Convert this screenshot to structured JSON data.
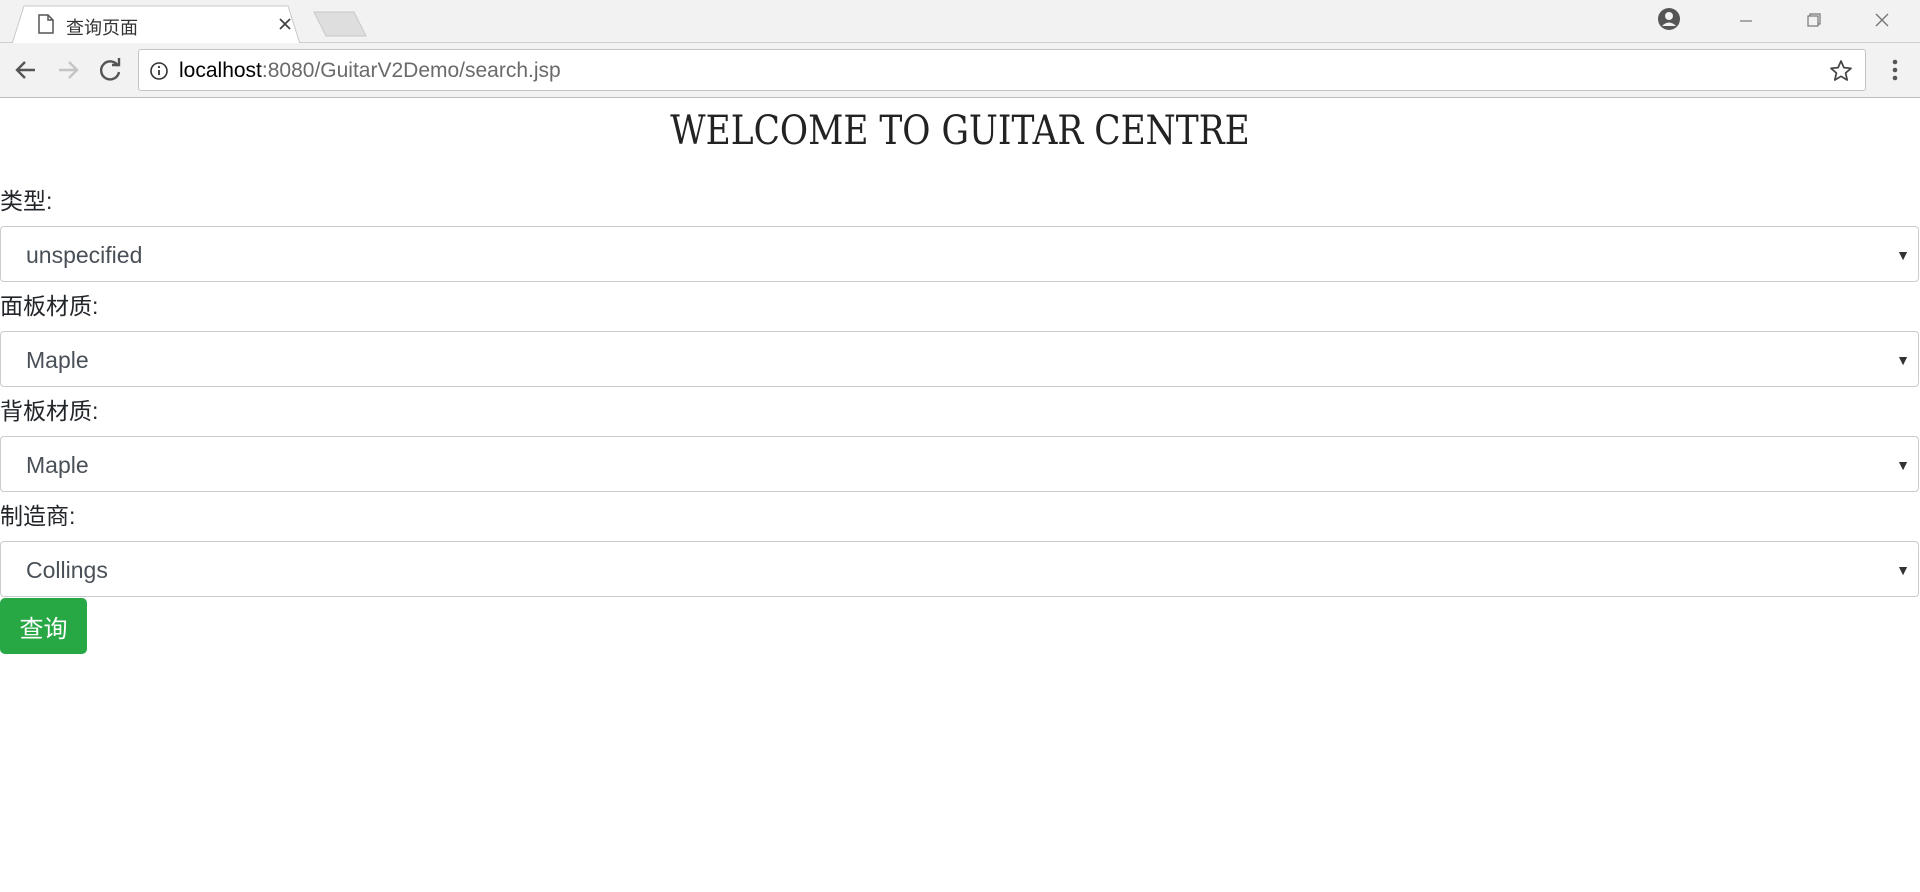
{
  "browser": {
    "tab_title": "查询页面",
    "url_host": "localhost",
    "url_rest": ":8080/GuitarV2Demo/search.jsp"
  },
  "page": {
    "heading": "WELCOME TO GUITAR CENTRE",
    "fields": [
      {
        "label": "类型:",
        "value": "unspecified"
      },
      {
        "label": "面板材质:",
        "value": "Maple"
      },
      {
        "label": "背板材质:",
        "value": "Maple"
      },
      {
        "label": "制造商:",
        "value": "Collings"
      }
    ],
    "submit_label": "查询"
  },
  "colors": {
    "submit_button": "#28a745",
    "chrome_background": "#f2f2f2"
  },
  "icons": [
    "page-icon",
    "close-icon",
    "profile-icon",
    "minimize-icon",
    "restore-icon",
    "window-close-icon",
    "back-icon",
    "forward-icon",
    "reload-icon",
    "info-icon",
    "star-icon",
    "menu-icon",
    "chevron-down-icon"
  ]
}
